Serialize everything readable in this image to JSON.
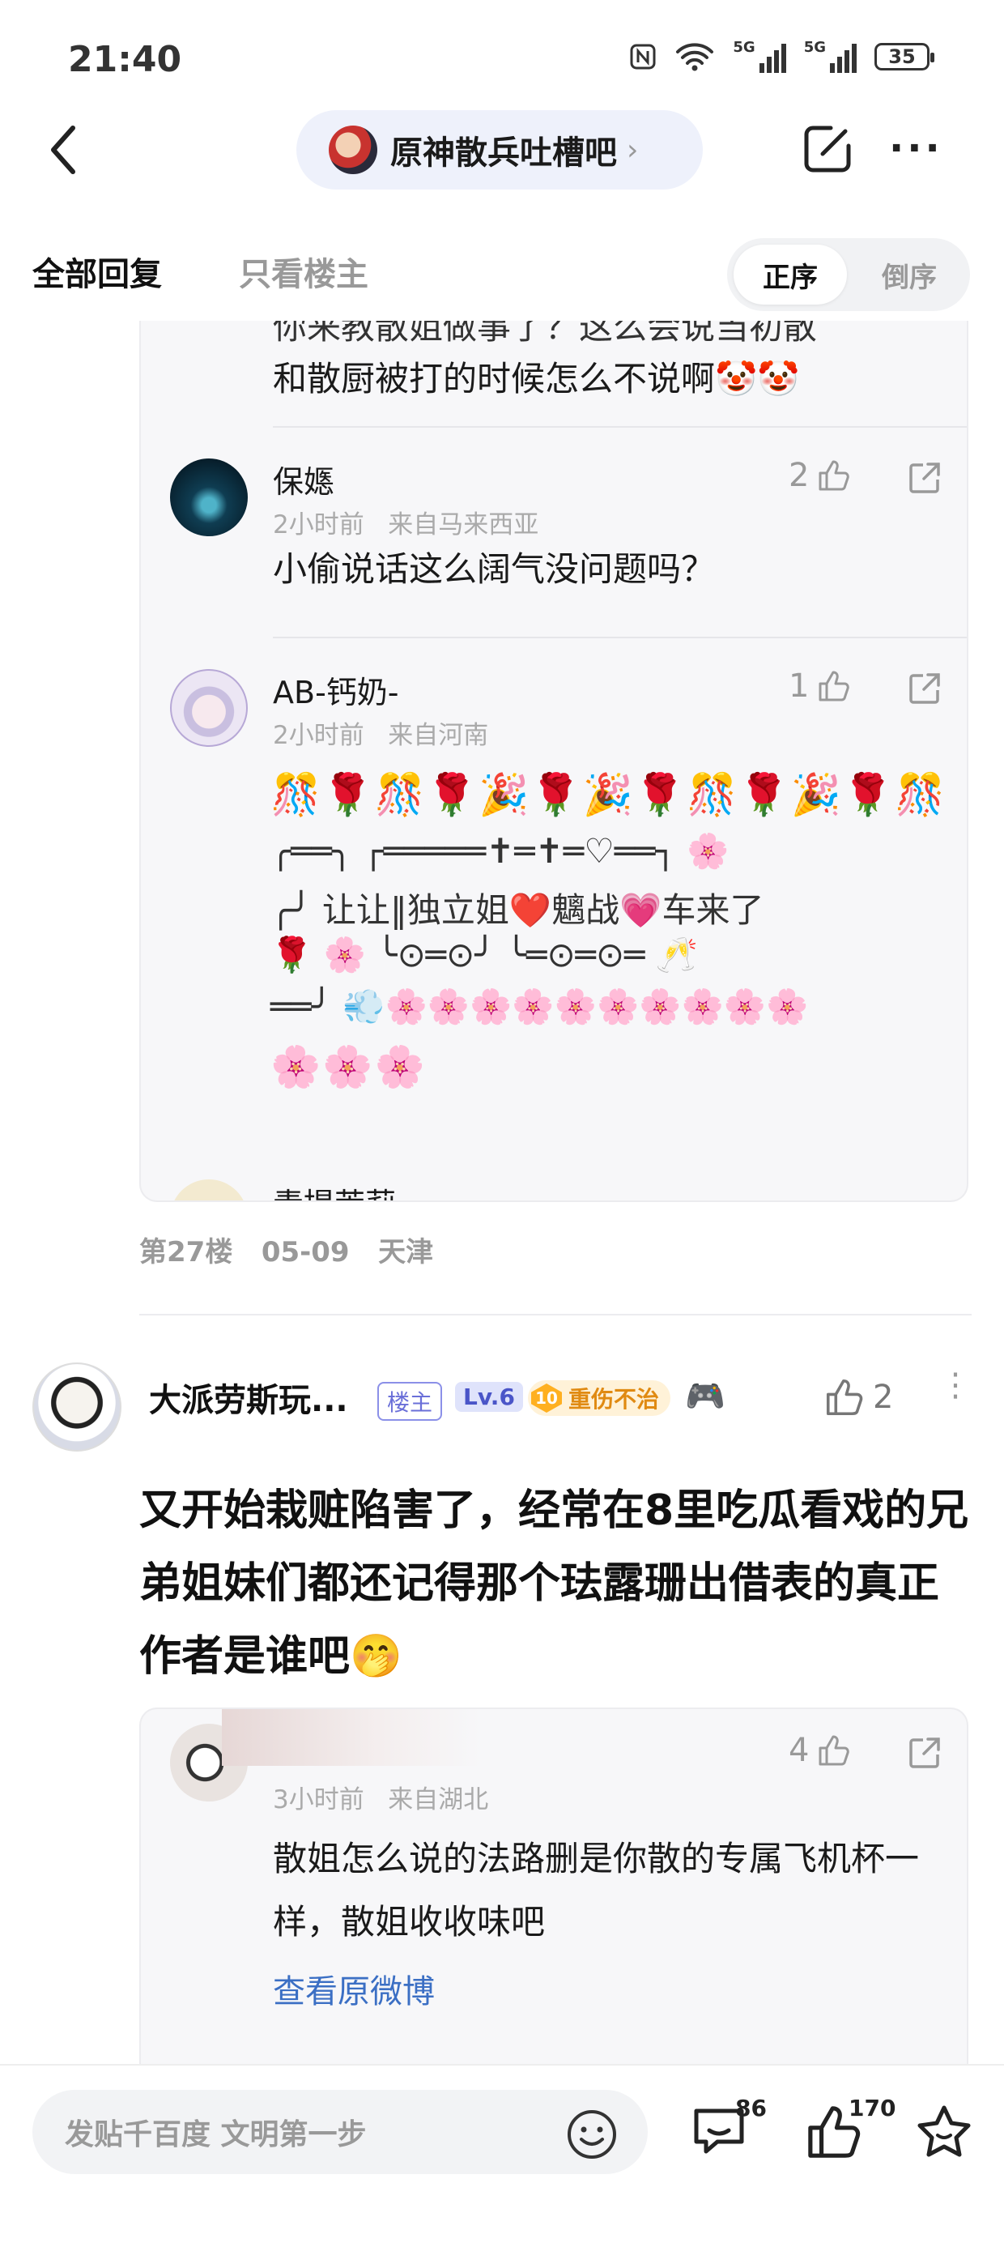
{
  "status_bar": {
    "time": "21:40",
    "nfc_icon": "nfc-icon",
    "network_1": "5G",
    "network_2": "5G",
    "battery": "35"
  },
  "nav": {
    "forum_name": "原神散兵吐槽吧",
    "chevron": "›",
    "back_icon": "back-arrow-icon",
    "edit_icon": "edit-icon",
    "more_icon": "···"
  },
  "tabs": {
    "all_replies": "全部回复",
    "op_only": "只看楼主",
    "sort_asc": "正序",
    "sort_desc": "倒序"
  },
  "floor27": {
    "cut_text": "你来教散姐做事了？这么会说当初散",
    "text_line2": "和散厨被打的时候怎么不说啊🤡🤡",
    "replies": [
      {
        "name": "保嫕",
        "time": "2小时前",
        "location": "来自马来西亚",
        "likes": "2",
        "text": "小偷说话这么阔气没问题吗？"
      },
      {
        "name": "AB-钙奶-",
        "time": "2小时前",
        "location": "来自河南",
        "likes": "1",
        "emoji_row1": "🎊🌹🎊🌹🎉🌹🎉🌹🎊🌹🎉🌹🎊",
        "deco_line1": "╭══╮  ┌═════✝═✝═♡══┐   🌸",
        "deco_line2": "╭╯  让让‖独立姐❤️魑战💗车来了",
        "deco_line3": "🌹 🌸  ╰⊙═⊙╯   ╰═⊙═⊙═ 🥂",
        "deco_line4": "══╯ 💨🌸🌸🌸🌸🌸🌸🌸🌸🌸🌸",
        "emoji_row2": "🌸🌸🌸"
      }
    ],
    "cut_next_name": "青提茉莉"
  },
  "floor_meta": {
    "floor": "第27楼",
    "date": "05-09",
    "location": "天津"
  },
  "post28": {
    "author": "大派劳斯玩...",
    "badge_op": "楼主",
    "badge_level": "Lv.6",
    "badge_rank": "10",
    "badge_title": "重伤不治",
    "extra_badge": "🎮",
    "likes": "2",
    "more": "⋮",
    "text": "又开始栽赃陷害了，经常在8里吃瓜看戏的兄弟姐妹们都还记得那个珐露珊出借表的真正作者是谁吧🤭",
    "reply": {
      "time": "3小时前",
      "location": "来自湖北",
      "likes": "4",
      "text": "散姐怎么说的法路删是你散的专属飞机杯一样，散姐收收味吧",
      "link": "查看原微博"
    }
  },
  "bottom_bar": {
    "placeholder": "发贴千百度 文明第一步",
    "comments": "86",
    "likes": "170",
    "smile_icon": "smile-icon",
    "comment_icon": "comment-icon",
    "like_icon": "thumb-up-icon",
    "star_icon": "star-icon"
  }
}
